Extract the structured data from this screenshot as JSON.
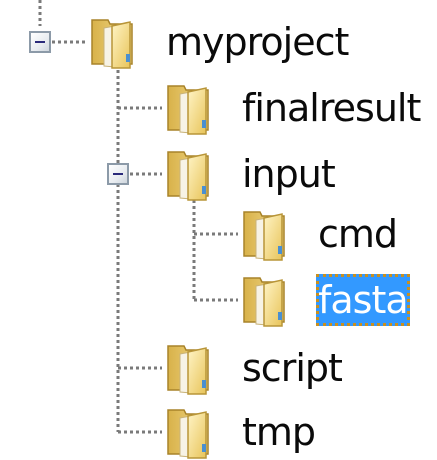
{
  "tree": {
    "root": {
      "label": "myproject",
      "expanded": true,
      "icon": "folder-icon"
    },
    "children": [
      {
        "label": "finalresult",
        "icon": "folder-icon"
      },
      {
        "label": "input",
        "expanded": true,
        "icon": "folder-icon",
        "children": [
          {
            "label": "cmd",
            "icon": "folder-icon"
          },
          {
            "label": "fasta",
            "icon": "folder-icon",
            "selected": true
          }
        ]
      },
      {
        "label": "script",
        "icon": "folder-icon"
      },
      {
        "label": "tmp",
        "icon": "folder-icon"
      }
    ]
  },
  "colors": {
    "selection_bg": "#3399ff",
    "selection_text": "#ffffff",
    "focus_outline": "#c89020",
    "connector": "#7a7a7a"
  }
}
